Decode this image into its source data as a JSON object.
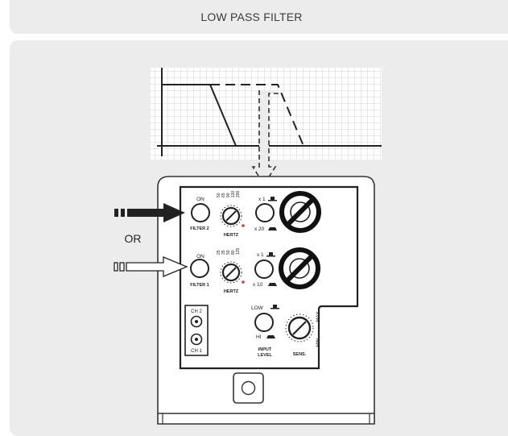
{
  "header": {
    "title": "LOW PASS FILTER"
  },
  "diagram": {
    "or_label": "OR",
    "filter2": {
      "on": "ON",
      "name": "FILTER 2",
      "freq_values": [
        "50",
        "65",
        "90",
        "130",
        "200"
      ],
      "unit": "HERTZ",
      "gain_high": "x 1",
      "gain_low": "x 20"
    },
    "filter1": {
      "on": "ON",
      "name": "FILTER 1",
      "freq_values": [
        "25",
        "35",
        "50",
        "80",
        "125"
      ],
      "unit": "HERTZ",
      "gain_high": "x 1",
      "gain_low": "x 10"
    },
    "channels": {
      "ch2": "CH 2",
      "ch1": "CH 1"
    },
    "input_level": {
      "low": "LOW",
      "hi": "HI",
      "caption_line1": "INPUT",
      "caption_line2": "LEVEL"
    },
    "sens": {
      "caption": "SENS.",
      "max": "MAX",
      "min": "MIN"
    }
  }
}
